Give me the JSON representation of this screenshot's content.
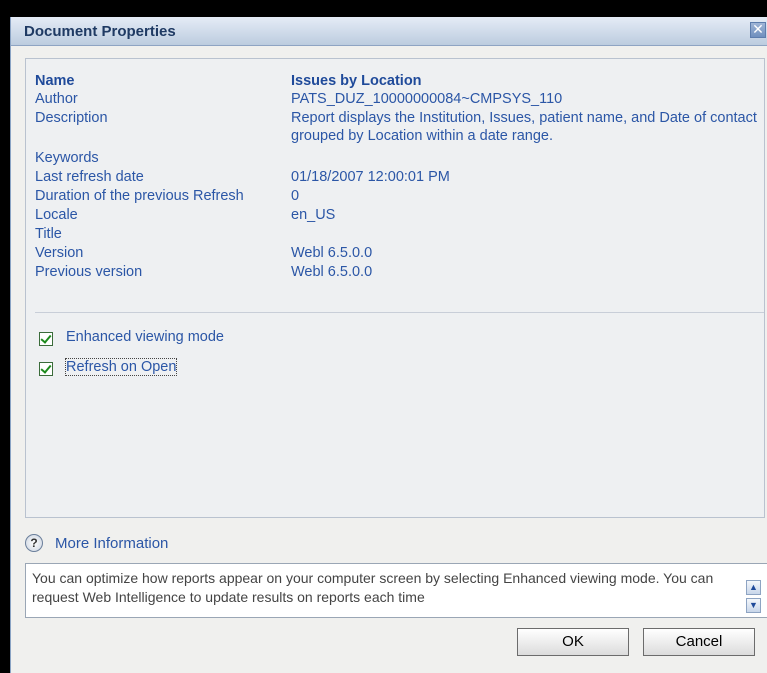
{
  "dialog": {
    "title": "Document Properties",
    "close_glyph": "✕"
  },
  "properties": [
    {
      "label": "Name",
      "value": "Issues by Location"
    },
    {
      "label": "Author",
      "value": "PATS_DUZ_10000000084~CMPSYS_110"
    },
    {
      "label": "Description",
      "value": "Report displays the Institution, Issues, patient name, and Date of contact grouped by Location within a date range."
    },
    {
      "label": "Keywords",
      "value": ""
    },
    {
      "label": "Last refresh date",
      "value": "01/18/2007 12:00:01 PM"
    },
    {
      "label": "Duration of the previous Refresh",
      "value": "0"
    },
    {
      "label": "Locale",
      "value": "en_US"
    },
    {
      "label": "Title",
      "value": ""
    },
    {
      "label": "Version",
      "value": "Webl 6.5.0.0"
    },
    {
      "label": "Previous version",
      "value": "Webl 6.5.0.0"
    }
  ],
  "options": {
    "enhanced_viewing": {
      "label": "Enhanced viewing mode",
      "checked": true
    },
    "refresh_on_open": {
      "label": "Refresh on Open",
      "checked": true
    }
  },
  "more_info": {
    "icon_glyph": "?",
    "label": "More Information",
    "text": "You can optimize how reports appear on your computer screen by selecting Enhanced viewing mode. You can request Web Intelligence to update results on reports each time"
  },
  "scroll": {
    "up_glyph": "▲",
    "down_glyph": "▼"
  },
  "buttons": {
    "ok": "OK",
    "cancel": "Cancel"
  }
}
